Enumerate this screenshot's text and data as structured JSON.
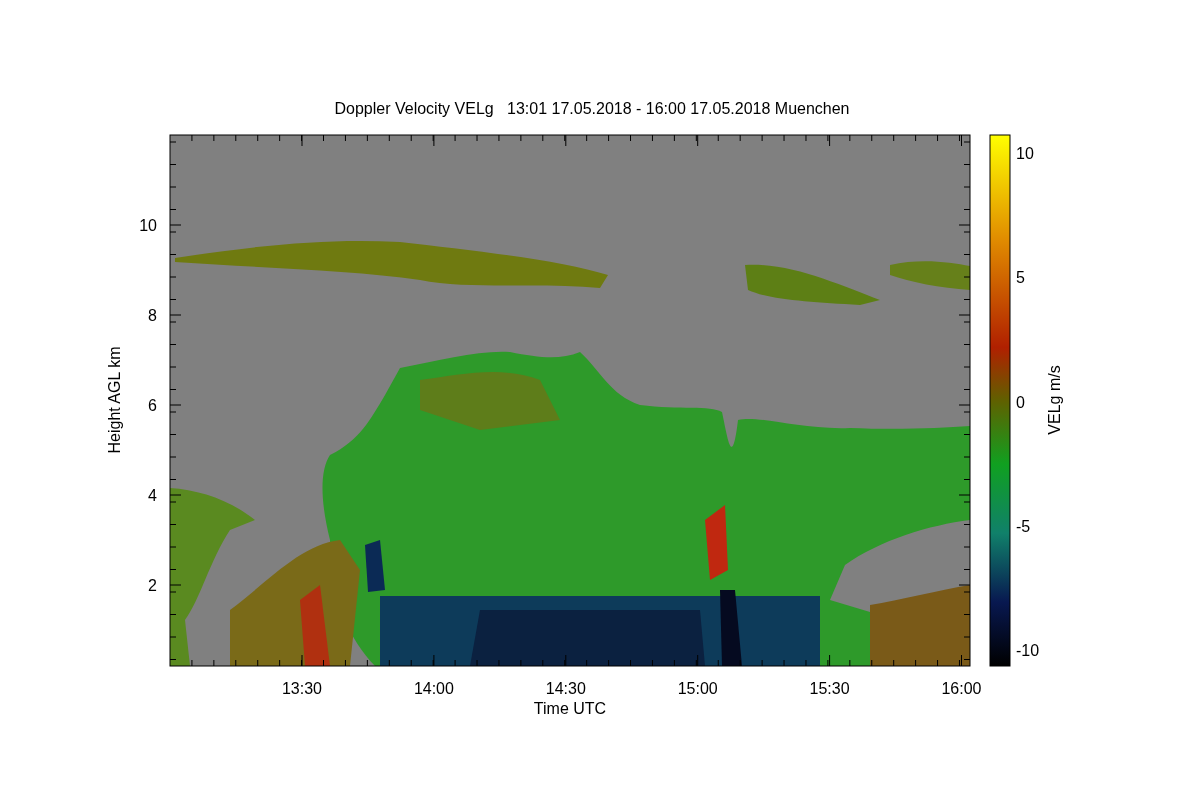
{
  "title": "Doppler Velocity VELg   13:01 17.05.2018 - 16:00 17.05.2018 Muenchen",
  "x_axis": {
    "label": "Time UTC",
    "ticks": [
      "13:30",
      "14:00",
      "14:30",
      "15:00",
      "15:30",
      "16:00"
    ]
  },
  "y_axis": {
    "label": "Height AGL km",
    "ticks": [
      "10",
      "8",
      "6",
      "4",
      "2"
    ]
  },
  "colorbar": {
    "label": "VELg m/s",
    "ticks": [
      "10",
      "5",
      "0",
      "-5",
      "-10"
    ]
  }
}
